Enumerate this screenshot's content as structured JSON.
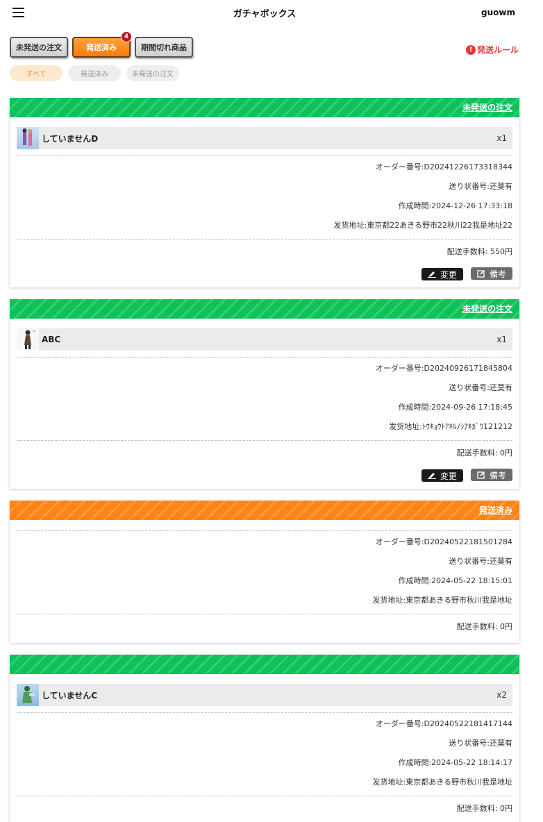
{
  "header": {
    "title": "ガチャボックス",
    "username": "guowm"
  },
  "tabs": [
    {
      "label": "未発送の注文"
    },
    {
      "label": "発送済み",
      "badge": "4"
    },
    {
      "label": "期間切れ商品"
    }
  ],
  "rules_link": {
    "label": "発送ルール"
  },
  "filters": [
    {
      "label": "すべて"
    },
    {
      "label": "発送済み"
    },
    {
      "label": "未発送の注文"
    }
  ],
  "orders": [
    {
      "status": "未発送の注文",
      "product": {
        "name": "していませんD",
        "qty": "x1"
      },
      "order_no": "オーダー番号:D20241226173318344",
      "tracking": "送り状番号:还莫有",
      "created": "作成時間:2024-12-26 17:33:18",
      "address": "发货地址:東京都22あきる野市22秋川22我是地址22",
      "fee": "配送手数料: 550円",
      "edit_label": "変更",
      "note_label": "備考"
    },
    {
      "status": "未発送の注文",
      "product": {
        "name": "ABC",
        "qty": "x1"
      },
      "order_no": "オーダー番号:D20240926171845804",
      "tracking": "送り状番号:还莫有",
      "created": "作成時間:2024-09-26 17:18:45",
      "address": "发货地址:ﾄｳｷｮｳﾄｱｷﾙﾉｼｱｷｶﾞﾜ121212",
      "fee": "配送手数料: 0円",
      "edit_label": "変更",
      "note_label": "備考"
    },
    {
      "status": "発送済み",
      "order_no": "オーダー番号:D20240522181501284",
      "tracking": "送り状番号:还莫有",
      "created": "作成時間:2024-05-22 18:15:01",
      "address": "发货地址:東京都あきる野市秋川我是地址",
      "fee": "配送手数料: 0円"
    },
    {
      "status": "",
      "product": {
        "name": "していませんC",
        "qty": "x2"
      },
      "order_no": "オーダー番号:D20240522181417144",
      "tracking": "送り状番号:还莫有",
      "created": "作成時間:2024-05-22 18:14:17",
      "address": "发货地址:東京都あきる野市秋川我是地址",
      "fee": "配送手数料: 0円"
    }
  ],
  "colors": {
    "pending": "#10c15a",
    "shipped": "#ff8418",
    "accent": "#e53935"
  }
}
